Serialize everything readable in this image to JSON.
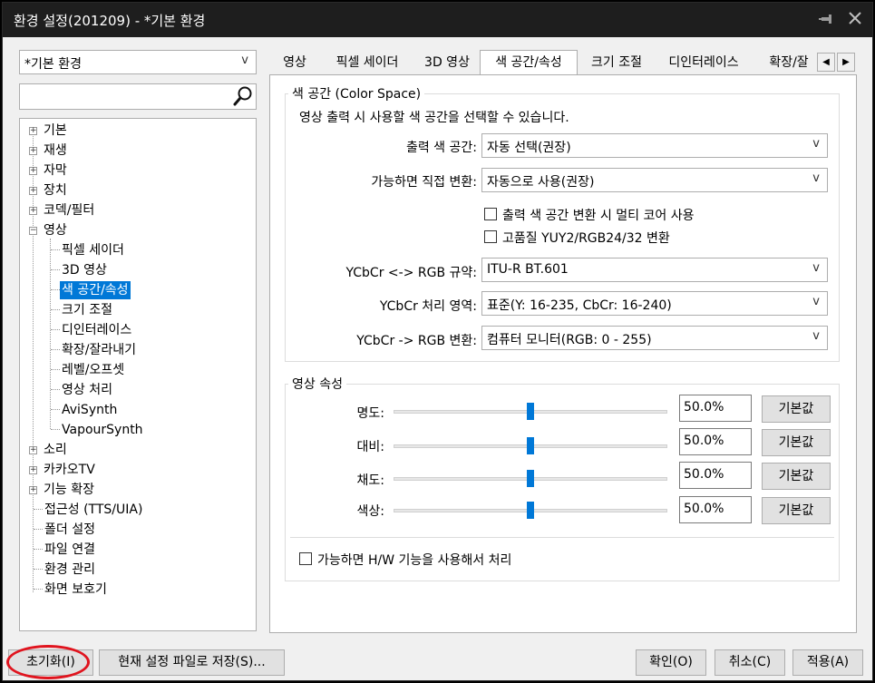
{
  "window": {
    "title": "환경 설정(201209) - *기본 환경",
    "pin_icon": "pin-icon",
    "close_icon": "close-icon"
  },
  "sidebar": {
    "profile_value": "*기본 환경",
    "profile_arrow": "v",
    "search_placeholder": "",
    "tree": [
      {
        "label": "기본",
        "expander": "+"
      },
      {
        "label": "재생",
        "expander": "+"
      },
      {
        "label": "자막",
        "expander": "+"
      },
      {
        "label": "장치",
        "expander": "+"
      },
      {
        "label": "코덱/필터",
        "expander": "+"
      },
      {
        "label": "영상",
        "expander": "−"
      },
      {
        "label": "픽셀 세이더"
      },
      {
        "label": "3D 영상"
      },
      {
        "label": "색 공간/속성",
        "selected": true
      },
      {
        "label": "크기 조절"
      },
      {
        "label": "디인터레이스"
      },
      {
        "label": "확장/잘라내기"
      },
      {
        "label": "레벨/오프셋"
      },
      {
        "label": "영상 처리"
      },
      {
        "label": "AviSynth"
      },
      {
        "label": "VapourSynth"
      },
      {
        "label": "소리",
        "expander": "+"
      },
      {
        "label": "카카오TV",
        "expander": "+"
      },
      {
        "label": "기능 확장",
        "expander": "+"
      },
      {
        "label": "접근성 (TTS/UIA)"
      },
      {
        "label": "폴더 설정"
      },
      {
        "label": "파일 연결"
      },
      {
        "label": "환경 관리"
      },
      {
        "label": "화면 보호기"
      }
    ]
  },
  "tabs": {
    "items": [
      "영상",
      "픽셀 세이더",
      "3D 영상",
      "색 공간/속성",
      "크기 조절",
      "디인터레이스",
      "확장/잘"
    ],
    "active": "색 공간/속성",
    "scroll_left": "◀",
    "scroll_right": "▶"
  },
  "color_space": {
    "title": "색 공간 (Color Space)",
    "description": "영상 출력 시 사용할 색 공간을 선택할 수 있습니다.",
    "output_label": "출력 색 공간:",
    "output_value": "자동 선택(권장)",
    "direct_label": "가능하면 직접 변환:",
    "direct_value": "자동으로 사용(권장)",
    "multicore_label": "출력 색 공간 변환 시 멀티 코어 사용",
    "multicore_checked": false,
    "hq_label": "고품질 YUY2/RGB24/32 변환",
    "hq_checked": false,
    "spec_label": "YCbCr <-> RGB 규약:",
    "spec_value": "ITU-R BT.601",
    "range_label": "YCbCr 처리 영역:",
    "range_value": "표준(Y: 16-235, CbCr: 16-240)",
    "conv_label": "YCbCr -> RGB 변환:",
    "conv_value": "컴퓨터 모니터(RGB: 0 - 255)",
    "arrow": "v"
  },
  "video_props": {
    "title": "영상 속성",
    "rows": [
      {
        "label": "명도:",
        "value": "50.0%",
        "level": 0.5,
        "button": "기본값"
      },
      {
        "label": "대비:",
        "value": "50.0%",
        "level": 0.5,
        "button": "기본값"
      },
      {
        "label": "채도:",
        "value": "50.0%",
        "level": 0.5,
        "button": "기본값"
      },
      {
        "label": "색상:",
        "value": "50.0%",
        "level": 0.5,
        "button": "기본값"
      }
    ],
    "hw_label": "가능하면 H/W 기능을 사용해서 처리",
    "hw_checked": false
  },
  "footer": {
    "reset_label": "초기화(I)",
    "save_label": "현재 설정 파일로 저장(S)...",
    "ok_label": "확인(O)",
    "cancel_label": "취소(C)",
    "apply_label": "적용(A)",
    "highlight_color": "#e0141e"
  },
  "colors": {
    "accent": "#0078d7",
    "titlebar": "#1e1e1e"
  }
}
